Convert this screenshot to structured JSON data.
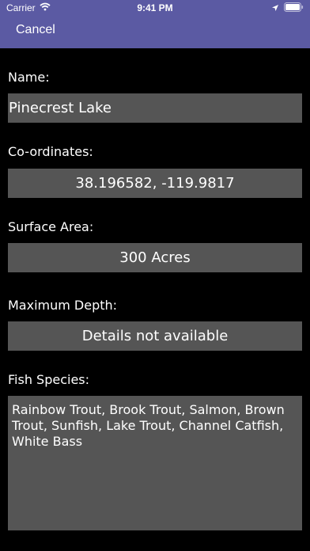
{
  "status_bar": {
    "carrier": "Carrier",
    "time": "9:41 PM"
  },
  "nav": {
    "cancel_label": "Cancel"
  },
  "form": {
    "name_label": "Name:",
    "name_value": "Pinecrest Lake",
    "coords_label": "Co-ordinates:",
    "coords_value": "38.196582, -119.9817",
    "surface_label": "Surface Area:",
    "surface_value": "300 Acres",
    "depth_label": "Maximum Depth:",
    "depth_value": "Details not available",
    "fish_label": "Fish Species:",
    "fish_value": "Rainbow Trout, Brook Trout, Salmon, Brown Trout, Sunfish, Lake Trout, Channel Catfish, White Bass"
  },
  "colors": {
    "bar_bg": "#5b5aa3",
    "page_bg": "#000000",
    "field_bg": "#555555",
    "text": "#ffffff"
  },
  "icons": [
    "wifi-icon",
    "location-arrow-icon",
    "battery-icon"
  ]
}
